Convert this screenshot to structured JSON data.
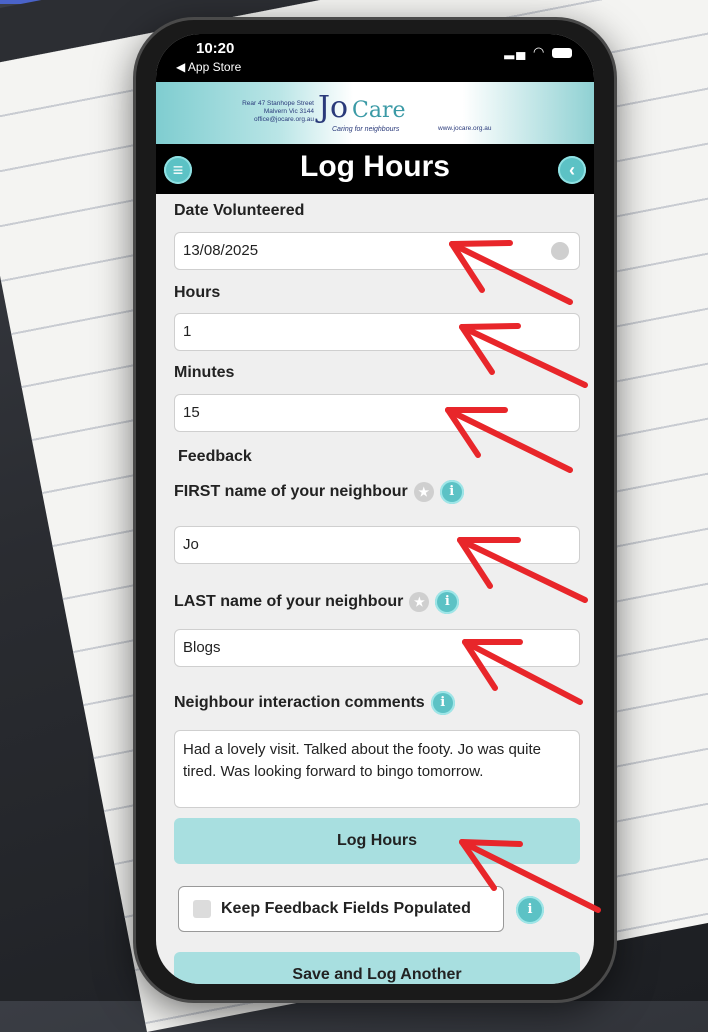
{
  "status": {
    "time": "10:20",
    "back_app": "◀ App Store"
  },
  "brand": {
    "address_line1": "Rear 47 Stanhope Street",
    "address_line2": "Malvern Vic 3144",
    "address_line3": "office@jocare.org.au",
    "logo_jo": "Jo",
    "logo_care": "Care",
    "tagline": "Caring for neighbours",
    "website": "www.jocare.org.au"
  },
  "header": {
    "title": "Log Hours",
    "menu_icon": "menu-icon",
    "back_icon": "back-icon"
  },
  "form": {
    "date_label": "Date Volunteered",
    "date_value": "13/08/2025",
    "hours_label": "Hours",
    "hours_value": "1",
    "minutes_label": "Minutes",
    "minutes_value": "15",
    "feedback_heading": "Feedback",
    "first_name_label": "FIRST name of your neighbour",
    "first_name_value": "Jo",
    "last_name_label": "LAST name of your neighbour",
    "last_name_value": "Blogs",
    "comments_label": "Neighbour interaction comments",
    "comments_value": "Had a lovely visit. Talked about the footy. Jo was quite tired. Was looking forward to bingo tomorrow.",
    "log_button": "Log Hours",
    "keep_fields_label": "Keep Feedback Fields Populated",
    "save_another_button": "Save and Log Another"
  },
  "colors": {
    "accent": "#5cc2c5",
    "button": "#a8dfe0",
    "arrow": "#e8262a"
  }
}
